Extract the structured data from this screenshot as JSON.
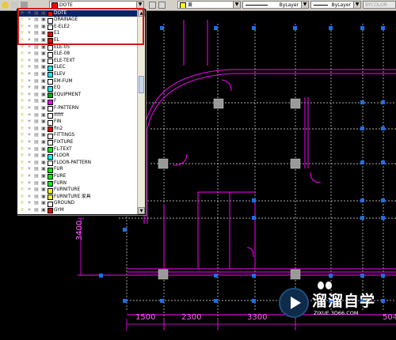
{
  "toolbar": {
    "layer_combo": {
      "value": "DOTE"
    },
    "color_combo": {
      "value": "黄"
    },
    "linetype_combo": {
      "value": "ByLayer"
    },
    "lineweight_combo": {
      "value": "ByLayer"
    },
    "plotstyle_combo": {
      "value": "BYCOLOR"
    }
  },
  "layer_dropdown": {
    "items": [
      {
        "name": "DOTE",
        "color": "#ff0000",
        "selected": true
      },
      {
        "name": "DRAINAGE",
        "color": "#ffffff"
      },
      {
        "name": "E-ELE2",
        "color": "#ffffff"
      },
      {
        "name": "E1",
        "color": "#ff0000"
      },
      {
        "name": "EL",
        "color": "#ff0000"
      },
      {
        "name": "ELE-05",
        "color": "#ffffff"
      },
      {
        "name": "ELE-08",
        "color": "#ffffff"
      },
      {
        "name": "ELE-TEXT",
        "color": "#ffffff"
      },
      {
        "name": "ELEC",
        "color": "#00ffff"
      },
      {
        "name": "ELEV",
        "color": "#00ffff"
      },
      {
        "name": "EM-FUM",
        "color": "#ffffff"
      },
      {
        "name": "EQ",
        "color": "#00ffff"
      },
      {
        "name": "EQUIPMENT",
        "color": "#00aa00"
      },
      {
        "name": "F",
        "color": "#ff00ff"
      },
      {
        "name": "F-PATTERN",
        "color": "#ffffff"
      },
      {
        "name": "ffffff",
        "color": "#ffffff"
      },
      {
        "name": "FIN",
        "color": "#ffffff"
      },
      {
        "name": "fin2",
        "color": "#ff0000"
      },
      {
        "name": "FITTINGS",
        "color": "#ffffff"
      },
      {
        "name": "FIXTURE",
        "color": "#ffffff"
      },
      {
        "name": "FL-TEXT",
        "color": "#00ff00"
      },
      {
        "name": "FLOOR",
        "color": "#00ffff"
      },
      {
        "name": "FLOOR-PATTERN",
        "color": "#ffffff"
      },
      {
        "name": "FUR",
        "color": "#00ff00"
      },
      {
        "name": "FURE",
        "color": "#00ff00"
      },
      {
        "name": "FURN",
        "color": "#00ff00"
      },
      {
        "name": "FURNITURE",
        "color": "#ffff00"
      },
      {
        "name": "FURNITURE 家具",
        "color": "#ffff00"
      },
      {
        "name": "GROUND",
        "color": "#ffffff"
      },
      {
        "name": "GYM",
        "color": "#ff0000"
      }
    ]
  },
  "drawing": {
    "vertical_dimension": "3400",
    "horizontal_dimensions": [
      "1500",
      "2300",
      "3300",
      "504"
    ]
  },
  "watermark": {
    "title": "溜溜自学",
    "url": "ZIXUE.3D66.COM"
  },
  "colors": {
    "wall": "#ff00ff",
    "grid": "#e0e0e0",
    "column_marker": "#1e6ee6",
    "highlight_box": "#d21a1a"
  }
}
